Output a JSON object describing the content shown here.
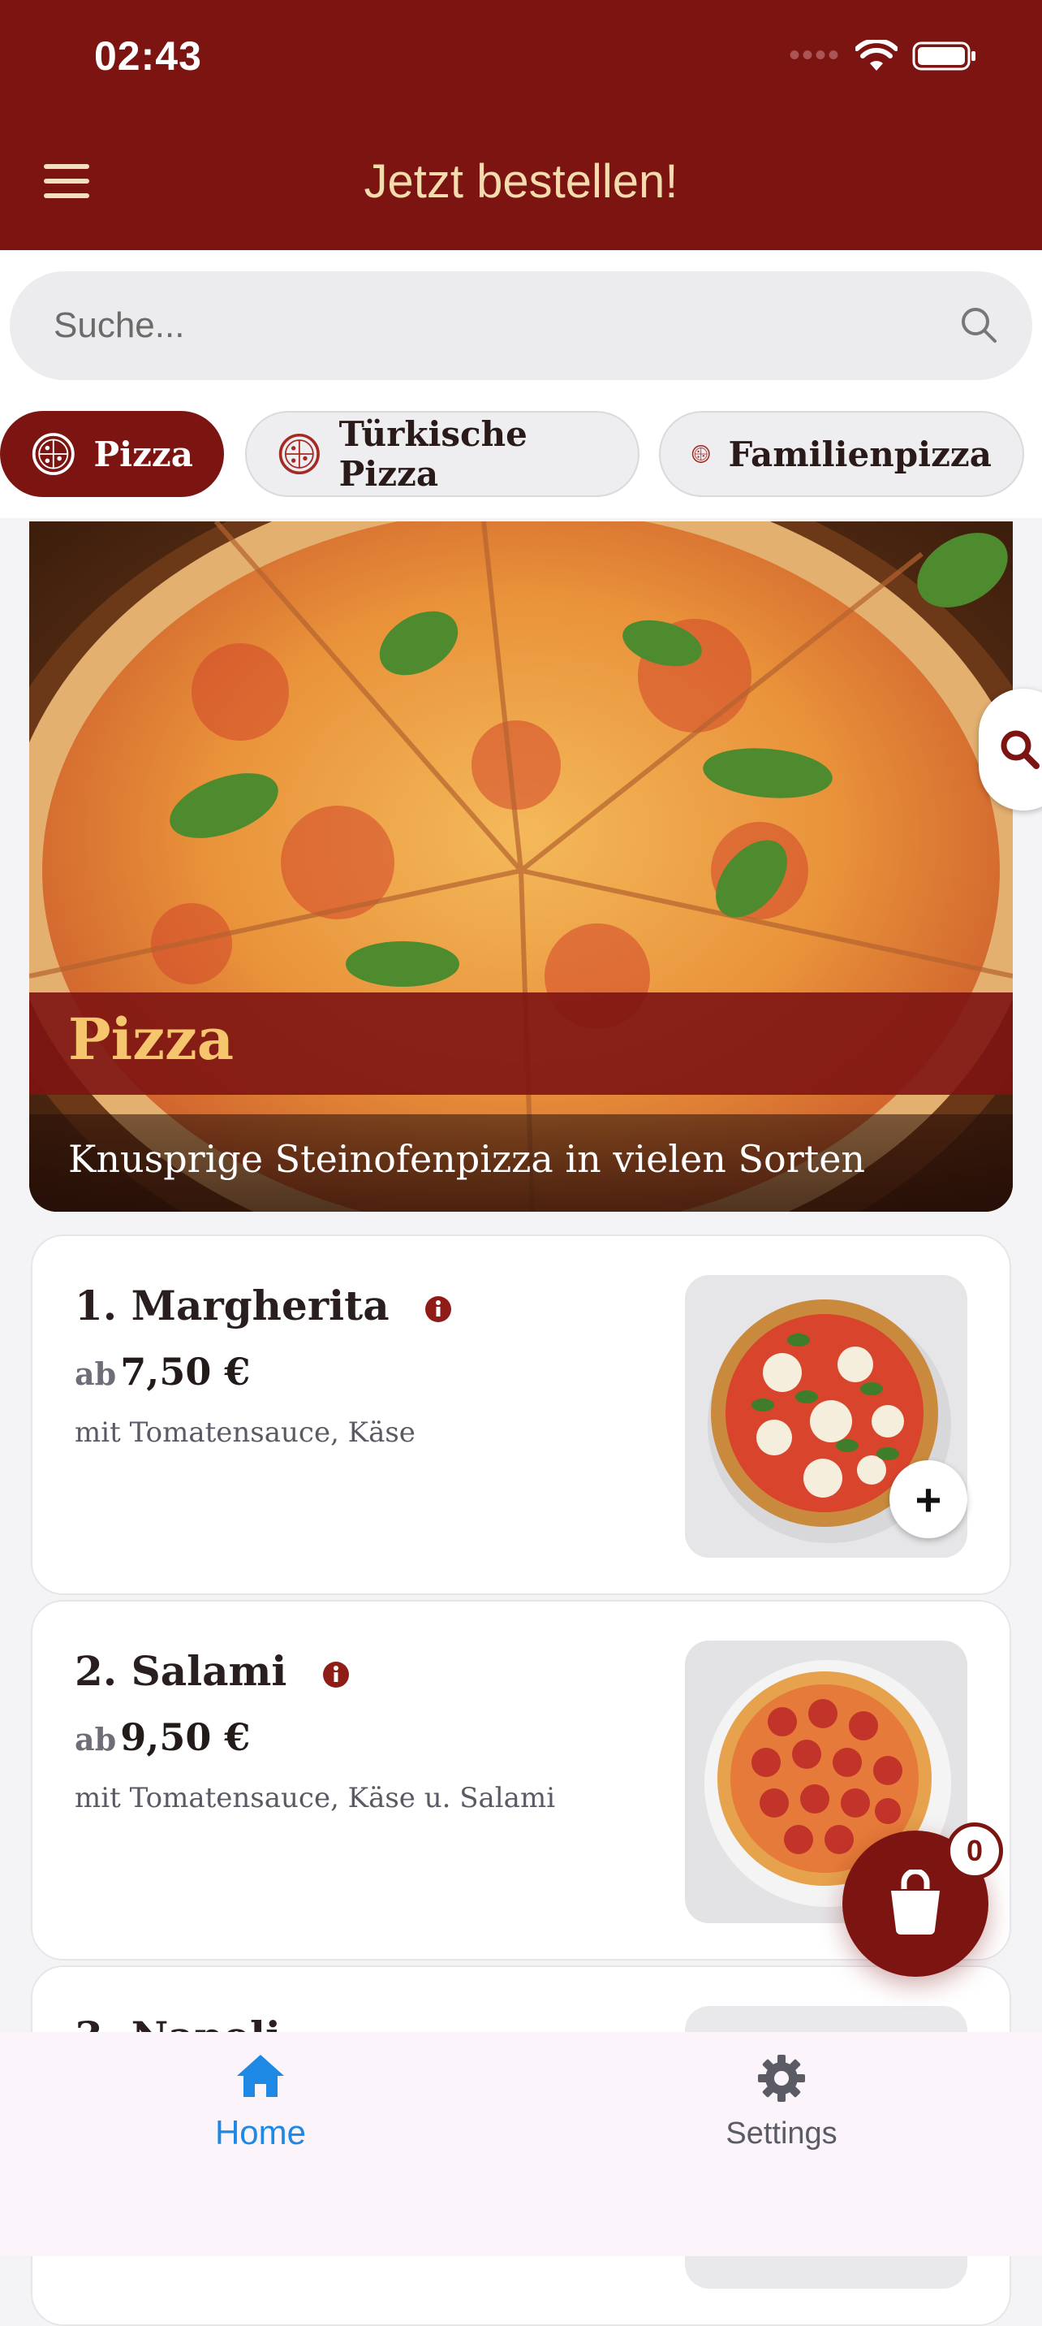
{
  "status_bar": {
    "time": "02:43"
  },
  "header": {
    "title": "Jetzt bestellen!"
  },
  "search": {
    "placeholder": "Suche..."
  },
  "categories": [
    {
      "label": "Pizza",
      "active": true
    },
    {
      "label": "Türkische Pizza",
      "active": false
    },
    {
      "label": "Familienpizza",
      "active": false
    }
  ],
  "hero": {
    "title": "Pizza",
    "subtitle": "Knusprige Steinofenpizza in vielen Sorten"
  },
  "products": [
    {
      "name": "1. Margherita",
      "price_prefix": "ab",
      "price": "7,50 €",
      "description": "mit Tomatensauce, Käse"
    },
    {
      "name": "2. Salami",
      "price_prefix": "ab",
      "price": "9,50 €",
      "description": "mit Tomatensauce, Käse u. Salami"
    },
    {
      "name": "3. Napoli"
    }
  ],
  "add_button": {
    "symbol": "+"
  },
  "cart": {
    "count": "0"
  },
  "bottom_nav": {
    "home": "Home",
    "settings": "Settings"
  },
  "colors": {
    "primary": "#7c1512",
    "accent_gold": "#f5c66d",
    "nav_active": "#1e88e5"
  }
}
